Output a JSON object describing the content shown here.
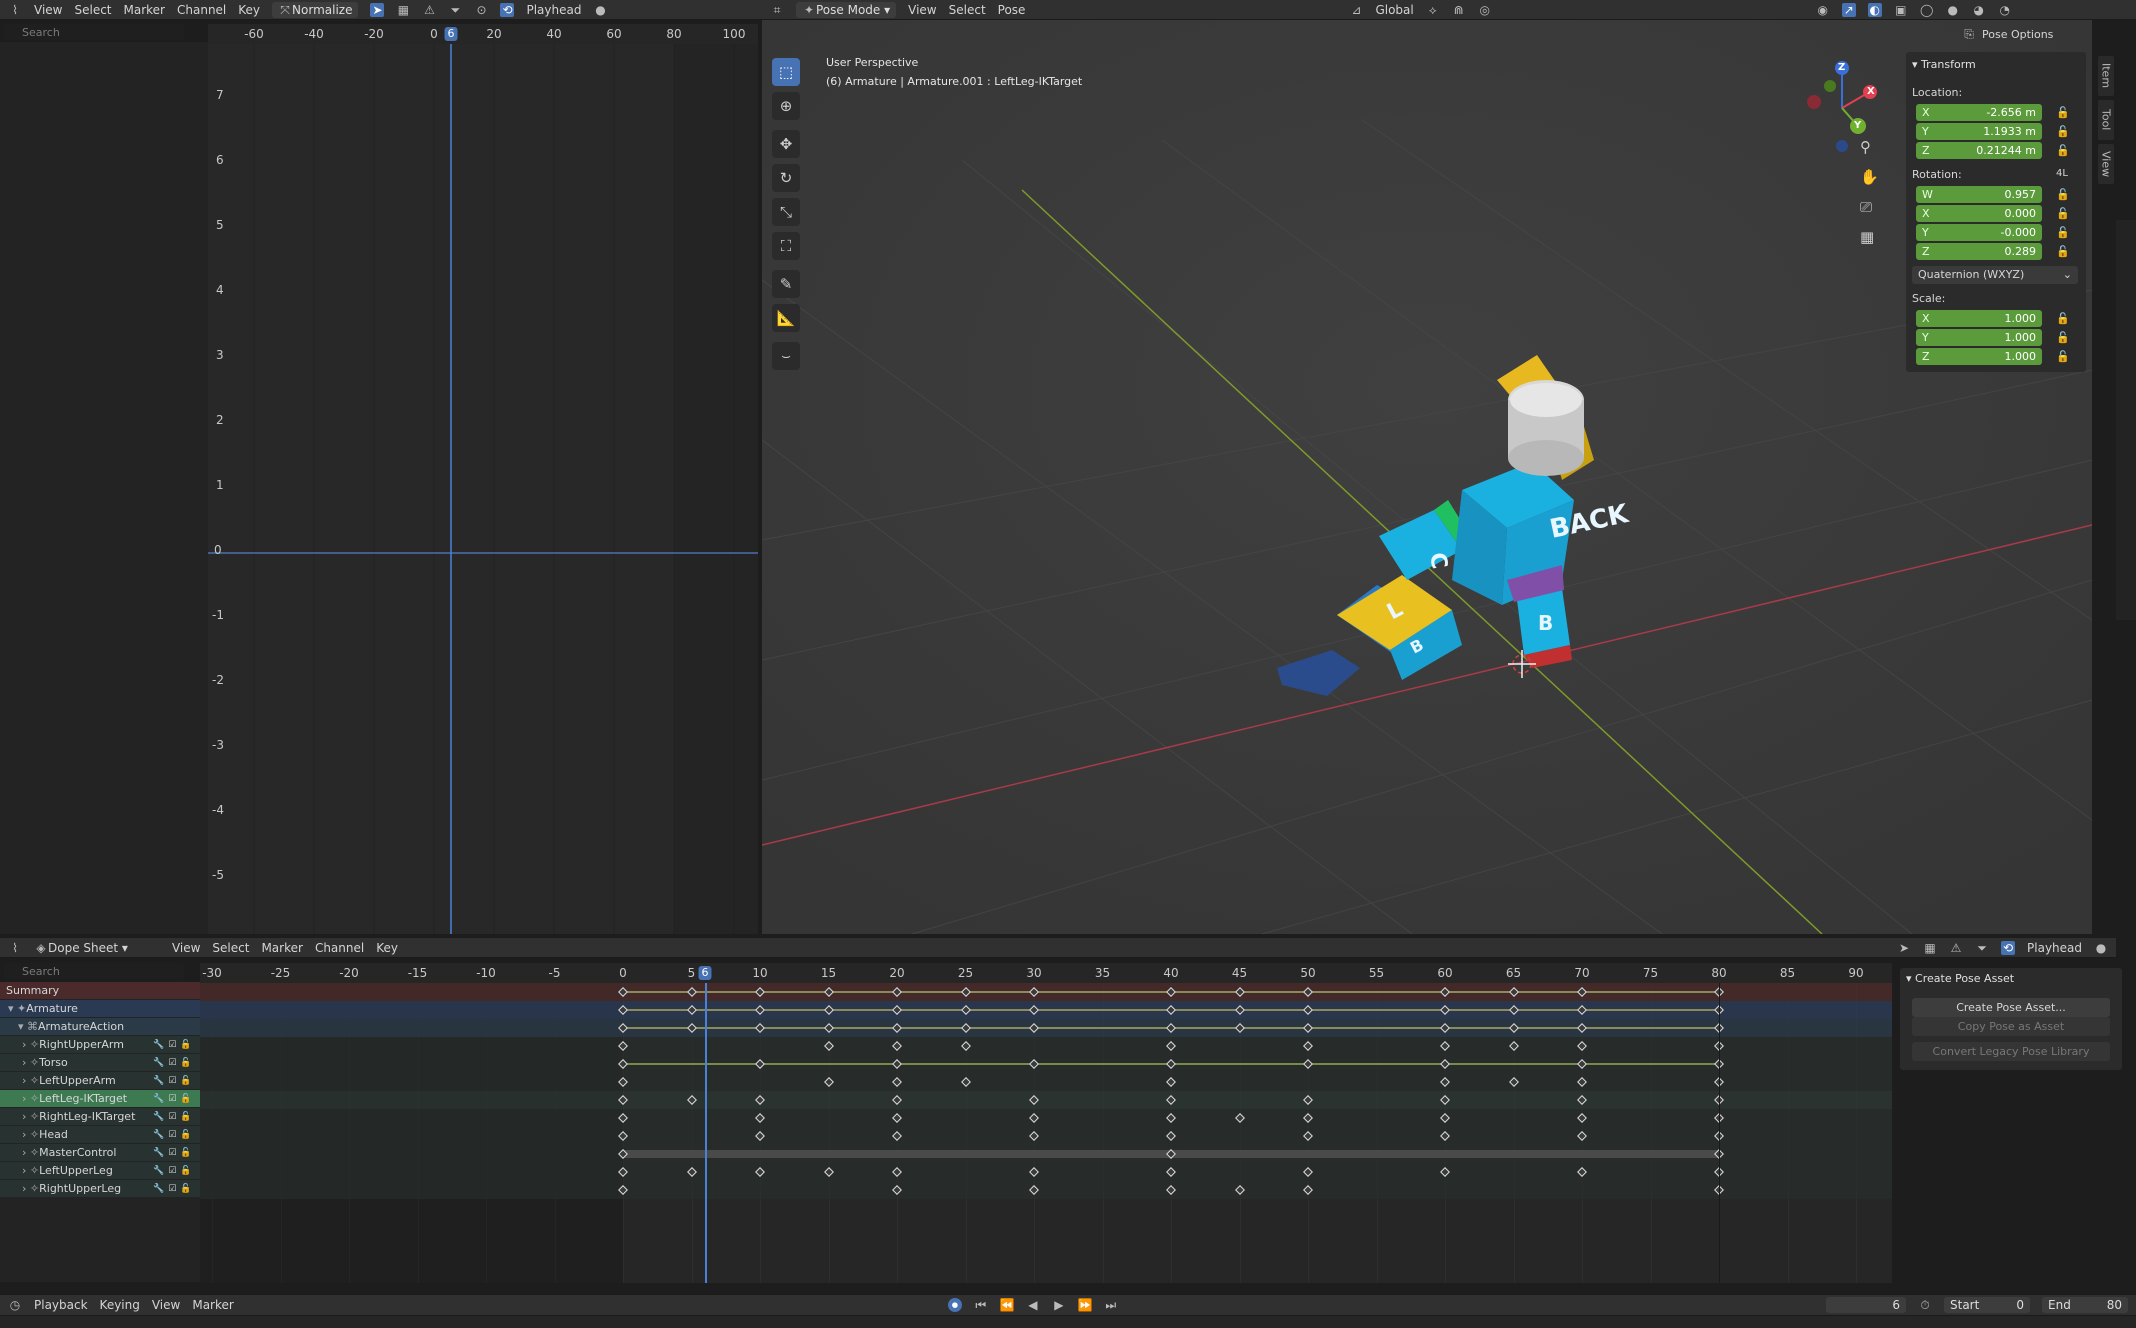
{
  "graph": {
    "menu": [
      "View",
      "Select",
      "Marker",
      "Channel",
      "Key"
    ],
    "normalize": "Normalize",
    "playhead_label": "Playhead",
    "search_placeholder": "Search",
    "ruler_ticks": [
      "-60",
      "-40",
      "-20",
      "0",
      "20",
      "40",
      "60",
      "80",
      "100"
    ],
    "current_frame": "6",
    "y_ticks": [
      "7",
      "6",
      "5",
      "4",
      "3",
      "2",
      "1",
      "0",
      "-1",
      "-2",
      "-3",
      "-4",
      "-5"
    ]
  },
  "viewport": {
    "mode": "Pose Mode",
    "menu": [
      "View",
      "Select",
      "Pose"
    ],
    "orientation": "Global",
    "pose_options": "Pose Options",
    "title": "User Perspective",
    "subtitle": "(6) Armature | Armature.001 : LeftLeg-IKTarget",
    "gizmo": {
      "x": "X",
      "y": "Y",
      "z": "Z"
    },
    "model_text": {
      "back": "BACK",
      "left": "L",
      "b1": "B",
      "b2": "B",
      "c": "C"
    },
    "tabs": [
      "Item",
      "Tool",
      "View"
    ],
    "accent": "#5b9b3c"
  },
  "transform": {
    "header": "Transform",
    "location_label": "Location:",
    "location": [
      {
        "axis": "X",
        "value": "-2.656 m"
      },
      {
        "axis": "Y",
        "value": "1.1933 m"
      },
      {
        "axis": "Z",
        "value": "0.21244 m"
      }
    ],
    "rotation_label": "Rotation:",
    "rotation_mode_badge": "4L",
    "rotation": [
      {
        "axis": "W",
        "value": "0.957"
      },
      {
        "axis": "X",
        "value": "0.000"
      },
      {
        "axis": "Y",
        "value": "-0.000"
      },
      {
        "axis": "Z",
        "value": "0.289"
      }
    ],
    "rotation_mode": "Quaternion (WXYZ)",
    "scale_label": "Scale:",
    "scale": [
      {
        "axis": "X",
        "value": "1.000"
      },
      {
        "axis": "Y",
        "value": "1.000"
      },
      {
        "axis": "Z",
        "value": "1.000"
      }
    ]
  },
  "dopesheet": {
    "editor": "Dope Sheet",
    "menu": [
      "View",
      "Select",
      "Marker",
      "Channel",
      "Key"
    ],
    "playhead_label": "Playhead",
    "search_placeholder": "Search",
    "ruler_ticks": [
      "-30",
      "-25",
      "-20",
      "-15",
      "-10",
      "-5",
      "0",
      "5",
      "10",
      "15",
      "20",
      "25",
      "30",
      "35",
      "40",
      "45",
      "50",
      "55",
      "60",
      "65",
      "70",
      "75",
      "80",
      "85",
      "90"
    ],
    "current_frame": "6",
    "channels": [
      {
        "name": "Summary",
        "kind": "summary"
      },
      {
        "name": "Armature",
        "kind": "object"
      },
      {
        "name": "ArmatureAction",
        "kind": "action"
      },
      {
        "name": "RightUpperArm",
        "kind": "bone"
      },
      {
        "name": "Torso",
        "kind": "bone"
      },
      {
        "name": "LeftUpperArm",
        "kind": "bone"
      },
      {
        "name": "LeftLeg-IKTarget",
        "kind": "bone-selected"
      },
      {
        "name": "RightLeg-IKTarget",
        "kind": "bone"
      },
      {
        "name": "Head",
        "kind": "bone"
      },
      {
        "name": "MasterControl",
        "kind": "bone"
      },
      {
        "name": "LeftUpperLeg",
        "kind": "bone"
      },
      {
        "name": "RightUpperLeg",
        "kind": "bone"
      }
    ],
    "keyframes": [
      [
        0,
        5,
        10,
        15,
        20,
        25,
        30,
        40,
        45,
        50,
        60,
        65,
        70,
        80
      ],
      [
        0,
        5,
        10,
        15,
        20,
        25,
        30,
        40,
        45,
        50,
        60,
        65,
        70,
        80
      ],
      [
        0,
        5,
        10,
        15,
        20,
        25,
        30,
        40,
        45,
        50,
        60,
        65,
        70,
        80
      ],
      [
        0,
        15,
        20,
        25,
        40,
        50,
        60,
        65,
        70,
        80
      ],
      [
        0,
        10,
        20,
        30,
        40,
        50,
        60,
        70,
        80
      ],
      [
        0,
        15,
        20,
        25,
        40,
        60,
        65,
        70,
        80
      ],
      [
        0,
        5,
        10,
        20,
        30,
        40,
        50,
        60,
        70,
        80
      ],
      [
        0,
        10,
        20,
        30,
        40,
        45,
        50,
        60,
        70,
        80
      ],
      [
        0,
        10,
        20,
        30,
        40,
        50,
        60,
        70,
        80
      ],
      [
        0,
        40,
        80
      ],
      [
        0,
        5,
        10,
        15,
        20,
        30,
        40,
        50,
        60,
        70,
        80
      ],
      [
        0,
        20,
        30,
        40,
        45,
        50,
        80
      ]
    ],
    "asset_panel": {
      "header": "Create Pose Asset",
      "buttons": [
        {
          "label": "Create Pose Asset...",
          "enabled": true
        },
        {
          "label": "Copy Pose as Asset",
          "enabled": false
        },
        {
          "label": "Convert Legacy Pose Library",
          "enabled": false
        }
      ]
    }
  },
  "timeline": {
    "menu": [
      "Playback",
      "Keying",
      "View",
      "Marker"
    ],
    "current_frame": "6",
    "start_label": "Start",
    "start": "0",
    "end_label": "End",
    "end": "80"
  }
}
